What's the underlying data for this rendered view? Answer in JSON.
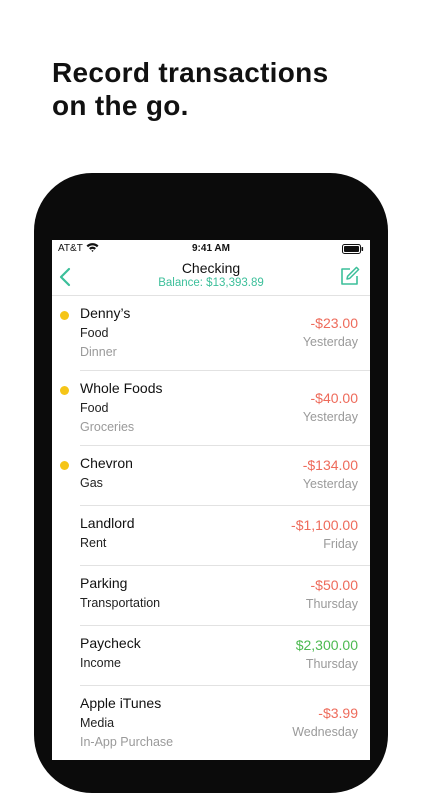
{
  "headline": {
    "line1": "Record transactions",
    "line2": "on the go."
  },
  "statusbar": {
    "carrier": "AT&T",
    "time": "9:41 AM"
  },
  "navbar": {
    "title": "Checking",
    "subtitle": "Balance: $13,393.89"
  },
  "colors": {
    "accent": "#3cbf9a",
    "negative": "#ee6b5b",
    "positive": "#4cb950",
    "pending_dot": "#f5c518"
  },
  "icons": {
    "back": "chevron-left-icon",
    "compose": "compose-icon",
    "wifi": "wifi-icon",
    "battery": "battery-icon"
  },
  "transactions": [
    {
      "name": "Denny’s",
      "category": "Food",
      "note": "Dinner",
      "amount": "-$23.00",
      "date": "Yesterday"
    },
    {
      "name": "Whole Foods",
      "category": "Food",
      "note": "Groceries",
      "amount": "-$40.00",
      "date": "Yesterday"
    },
    {
      "name": "Chevron",
      "category": "Gas",
      "amount": "-$134.00",
      "date": "Yesterday"
    },
    {
      "name": "Landlord",
      "category": "Rent",
      "amount": "-$1,100.00",
      "date": "Friday"
    },
    {
      "name": "Parking",
      "category": "Transportation",
      "amount": "-$50.00",
      "date": "Thursday"
    },
    {
      "name": "Paycheck",
      "category": "Income",
      "amount": "$2,300.00",
      "date": "Thursday"
    },
    {
      "name": "Apple iTunes",
      "category": "Media",
      "note": "In-App Purchase",
      "amount": "-$3.99",
      "date": "Wednesday"
    }
  ]
}
